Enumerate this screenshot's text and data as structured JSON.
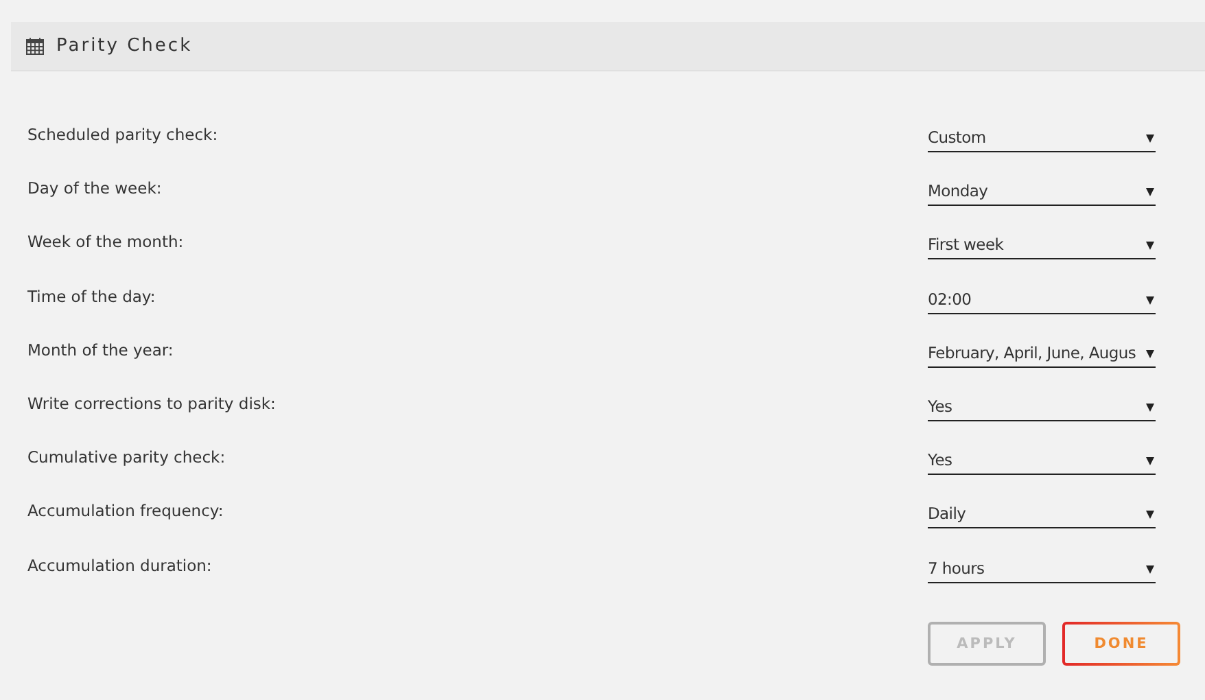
{
  "panel": {
    "title": "Parity Check"
  },
  "settings": [
    {
      "label": "Scheduled parity check:",
      "value": "Custom"
    },
    {
      "label": "Day of the week:",
      "value": "Monday"
    },
    {
      "label": "Week of the month:",
      "value": "First week"
    },
    {
      "label": "Time of the day:",
      "value": "02:00"
    },
    {
      "label": "Month of the year:",
      "value": "February, April, June, Augus"
    },
    {
      "label": "Write corrections to parity disk:",
      "value": "Yes"
    },
    {
      "label": "Cumulative parity check:",
      "value": "Yes"
    },
    {
      "label": "Accumulation frequency:",
      "value": "Daily"
    },
    {
      "label": "Accumulation duration:",
      "value": "7 hours"
    }
  ],
  "buttons": [
    {
      "label": "APPLY",
      "disabled": true
    },
    {
      "label": "DONE",
      "disabled": false
    }
  ]
}
